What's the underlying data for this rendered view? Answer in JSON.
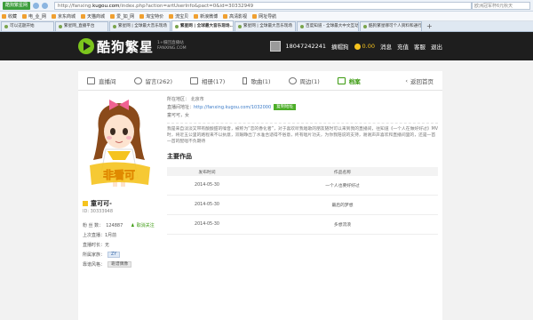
{
  "browser": {
    "badge": "酷狗繁星网",
    "url_prefix": "http://fanxing.",
    "url_host": "kugou.com",
    "url_rest": "/index.php?action=artUserInfo&pact=0&id=30332949",
    "search_placeholder": "欧洲冠军杯6元秋天"
  },
  "favorites": [
    "收藏",
    "电_业_网",
    "京东商城",
    "天猫商城",
    "爱_如_网",
    "淘宝特价",
    "流宝贝",
    "新浪微博",
    "高清影视",
    "网址导航"
  ],
  "favorites_right": [
    "扩展",
    "网银",
    "翻译",
    "截图",
    "登录"
  ],
  "tabs": [
    {
      "label": "可以这题开始"
    },
    {
      "label": "繁星网_直播平台"
    },
    {
      "label": "繁星网 | 全球最大音乐现场"
    },
    {
      "label": "繁星网 | 全球最大音乐现场..",
      "active": true
    },
    {
      "label": "繁星网 | 全球最大音乐现场"
    },
    {
      "label": "百度知道 - 全球最大中文互动问"
    },
    {
      "label": "酷狗繁星哪可个人资料和通行"
    }
  ],
  "site": {
    "logo": "酷狗繁星",
    "logo_sub1": "1+摄回直播站",
    "logo_sub2": "FANXING.COM",
    "phone": "18047242241",
    "coin_icon": "gold-coin",
    "coins": "0.00",
    "nav": [
      "摘帽狗",
      "消息",
      "充值",
      "客服",
      "退出"
    ]
  },
  "subnav": [
    {
      "label": "直播间",
      "icon": "tv-icon"
    },
    {
      "label": "留言(262)",
      "icon": "message-icon"
    },
    {
      "label": "相册(17)",
      "icon": "photo-icon"
    },
    {
      "label": "歌曲(1)",
      "icon": "music-icon"
    },
    {
      "label": "周边(1)",
      "icon": "location-icon"
    },
    {
      "label": "档案",
      "icon": "profile-icon",
      "active": true
    }
  ],
  "back_label": "返回首页",
  "profile": {
    "name": "童可可-",
    "uid": "ID: 30333948",
    "fans_label": "粉 丝 数：",
    "fans": "124887",
    "follow_label": "取消关注",
    "last_live": "上次直播：1月前",
    "live_time": "直播时长：无",
    "family_label": "所属家族：",
    "family": "ZY",
    "style_label": "靠谱风格：",
    "style": "靠谱偶像"
  },
  "info": {
    "region": "所在地区： 北京市",
    "room_label": "直播间地址：",
    "room_link": "http://fanxing.kugou.com/1032000",
    "copy_btn": "复制地址",
    "signature": "童可可，女",
    "desc": "我是来自淡淡又带有酸酸甜的嗓音，被称为“恋的香化者”，对于喜欢听我唱歌的朋友随时可以来到我的直播间，往知道《一个人在做好好过》MV 时，将近五公里的路程来不以执意，双眼睁出了水准合适得不俗意，终有唱片功夫，为你我陪说的支持，谢谢声声喜欢和直播间里的，还是一首一首的配唱不负期待"
  },
  "works": {
    "title": "主要作品",
    "col1": "发布时间",
    "col2": "作品名称",
    "rows": [
      {
        "date": "2014-05-30",
        "name": "一个人也要好好过"
      },
      {
        "date": "2014-05-30",
        "name": "最后的梦想"
      },
      {
        "date": "2014-05-30",
        "name": "多想流浪"
      }
    ]
  }
}
